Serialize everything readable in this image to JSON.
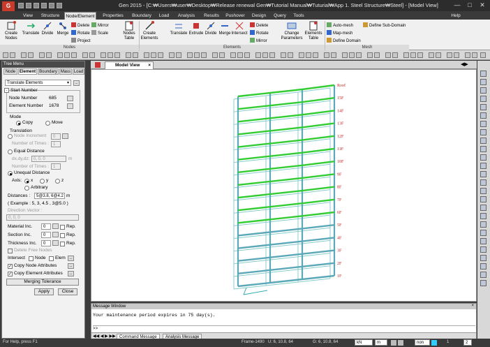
{
  "window": {
    "title": "Gen 2015 - [C:₩Users₩user₩Desktop₩Release renewal Gen₩Tutorial Manual₩Tuturial₩App 1. Steel Structure₩Steel] - [Model View]",
    "logo": "G",
    "help_label": "Help"
  },
  "menu_tabs": [
    "View",
    "Structure",
    "Node/Element",
    "Properties",
    "Boundary",
    "Load",
    "Analysis",
    "Results",
    "Pushover",
    "Design",
    "Query",
    "Tools"
  ],
  "ribbon": {
    "nodes_group": "Nodes",
    "elements_group": "Elements",
    "mesh_group": "Mesh",
    "create_nodes": "Create Nodes",
    "translate": "Translate",
    "divide": "Divide",
    "merge": "Merge",
    "delete": "Delete",
    "rotate": "Rotate",
    "project": "Project",
    "mirror": "Mirror",
    "scale": "Scale",
    "nodes_table": "Nodes Table",
    "create_elements": "Create Elements",
    "translate2": "Translate",
    "extrude": "Extrude",
    "divide2": "Divide",
    "merge2": "Merge",
    "intersect": "Intersect",
    "delete2": "Delete",
    "rotate2": "Rotate",
    "mirror2": "Mirror",
    "change_parameters": "Change Parameters",
    "elements_table": "Elements Table",
    "auto_mesh": "Auto-mesh",
    "map_mesh": "Map-mesh",
    "define_domain": "Define Domain",
    "define_sub_domain": "Define Sub-Domain"
  },
  "tree": {
    "header": "Tree Menu",
    "tabs": [
      "Node",
      "Element",
      "Boundary",
      "Mass",
      "Load"
    ],
    "function": "Translate Elements",
    "start_number": "Start Number",
    "node_number_label": "Node Number",
    "node_number": "685",
    "element_number_label": "Element Number",
    "element_number": "1678",
    "mode": "Mode",
    "copy": "Copy",
    "move": "Move",
    "translation": "Translation",
    "node_increment": "Node Increment",
    "node_increment_value": "0",
    "number_of_times": "Number of Times :",
    "number_of_times_value": "1",
    "equal_distance": "Equal Distance",
    "dxdydz": "dx,dy,dz:",
    "dxdydz_value": "0, 0, 0",
    "unit_m": "m",
    "number_of_times2": "Number of Times :",
    "number_of_times_value2": "1",
    "unequal_distance": "Unequal Distance",
    "axis": "Axis:",
    "x": "x",
    "y": "y",
    "z": "z",
    "arbitrary": "Arbitrary",
    "distances_label": "Distances :",
    "distances_value": "5@3.8, 6@4.2",
    "example": "( Example :  5, 3, 4.5 , 3@5.0 )",
    "direction_vector": "Direction Vector :",
    "direction_vector_value": "0, 0, 0",
    "material_inc": "Material Inc.",
    "section_inc": "Section Inc.",
    "thickness_inc": "Thickness Inc.",
    "inc_value": "0",
    "rep": "Rep.",
    "delete_free_nodes": "Delete Free Nodes",
    "intersect": "Intersect",
    "node": "Node",
    "elem": "Elem",
    "copy_node_attributes": "Copy Node Attributes",
    "copy_element_attributes": "Copy Element Attributes",
    "merging_tolerance": "Merging Tolerance",
    "apply": "Apply",
    "close": "Close",
    "more": "..."
  },
  "model_view": {
    "tab": "Model View",
    "story_labels": [
      "Roof",
      "15F",
      "14F",
      "13F",
      "12F",
      "11F",
      "10F",
      "9F",
      "8F",
      "7F",
      "6F",
      "5F",
      "4F",
      "3F",
      "2F",
      "1F"
    ]
  },
  "message": {
    "header": "Message Window",
    "text": "Your maintenance period expires in 75 day(s).",
    "prompt": ">>",
    "tabs": [
      "Command Message",
      "Analysis Message"
    ]
  },
  "status": {
    "help": "For Help, press F1",
    "frame": "Frame-1490",
    "u_coord": "U: 6, 10.8, 64",
    "g_coord": "G: 6, 10.8, 64",
    "unit_force": "kN",
    "unit_len": "m",
    "page": "1",
    "page_of": "2",
    "none": "non"
  },
  "colors": {
    "accent": "#c83a2a",
    "member": "#5aa8b8",
    "selected": "#33cc33",
    "label": "#cc2222"
  }
}
